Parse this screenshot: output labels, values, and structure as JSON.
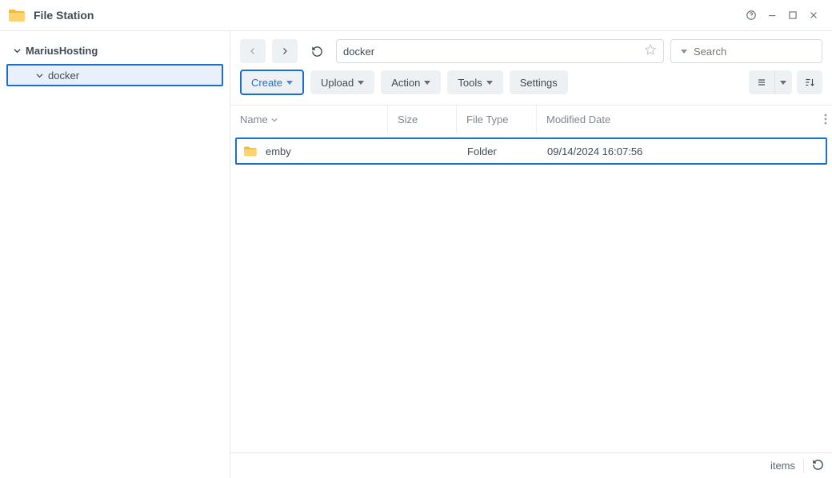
{
  "app": {
    "title": "File Station"
  },
  "sidebar": {
    "root": "MariusHosting",
    "child": "docker"
  },
  "nav": {
    "path_text": "docker",
    "search_placeholder": "Search"
  },
  "toolbar": {
    "create": "Create",
    "upload": "Upload",
    "action": "Action",
    "tools": "Tools",
    "settings": "Settings"
  },
  "columns": {
    "name": "Name",
    "size": "Size",
    "type": "File Type",
    "modified": "Modified Date"
  },
  "rows": [
    {
      "name": "emby",
      "size": "",
      "type": "Folder",
      "modified": "09/14/2024 16:07:56"
    }
  ],
  "status": {
    "items_label": "items"
  }
}
